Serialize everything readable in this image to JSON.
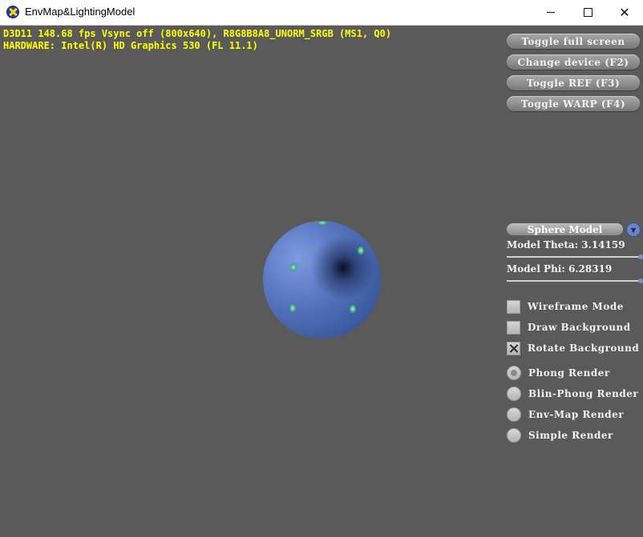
{
  "window": {
    "title": "EnvMap&LightingModel",
    "icon": "directx-x-icon"
  },
  "overlay": {
    "stats_line": "D3D11 148.68 fps  Vsync off (800x640), R8G8B8A8_UNORM_SRGB (MS1, Q0)",
    "device_line": "HARDWARE: Intel(R) HD Graphics 530 (FL 11.1)",
    "text_color": "#ffff00"
  },
  "buttons": {
    "toggle_fullscreen": "Toggle full screen",
    "change_device": "Change device (F2)",
    "toggle_ref": "Toggle REF (F3)",
    "toggle_warp": "Toggle WARP (F4)"
  },
  "model_select": {
    "selected": "Sphere Model"
  },
  "sliders": {
    "theta": {
      "label": "Model Theta: 3.14159",
      "value": 3.14159
    },
    "phi": {
      "label": "Model   Phi: 6.28319",
      "value": 6.28319
    }
  },
  "checkboxes": [
    {
      "label": "Wireframe Mode",
      "checked": false
    },
    {
      "label": "Draw Background",
      "checked": false
    },
    {
      "label": "Rotate Background",
      "checked": true
    }
  ],
  "render_modes": [
    {
      "label": "Phong Render",
      "selected": true
    },
    {
      "label": "Blin-Phong Render",
      "selected": false
    },
    {
      "label": "Env-Map Render",
      "selected": false
    },
    {
      "label": "Simple Render",
      "selected": false
    }
  ],
  "colors": {
    "background": "#5a5a5a",
    "sphere": "#5b78c3",
    "accent": "#6b83c9"
  }
}
